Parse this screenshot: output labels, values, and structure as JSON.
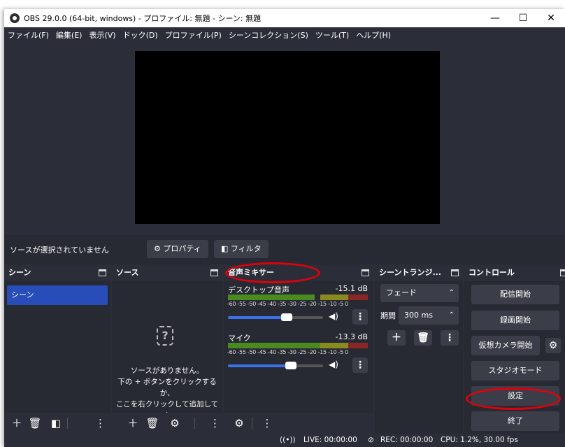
{
  "window": {
    "title": "OBS 29.0.0 (64-bit, windows) - プロファイル: 無題 - シーン: 無題",
    "minimize": "—",
    "maximize": "☐",
    "close": "✕"
  },
  "menu": [
    "ファイル(F)",
    "編集(E)",
    "表示(V)",
    "ドック(D)",
    "プロファイル(P)",
    "シーンコレクション(S)",
    "ツール(T)",
    "ヘルプ(H)"
  ],
  "source_bar": {
    "no_source": "ソースが選択されていません",
    "properties": "プロパティ",
    "filters": "フィルタ"
  },
  "scenes": {
    "title": "シーン",
    "items": [
      "シーン"
    ]
  },
  "sources": {
    "title": "ソース",
    "empty_line1": "ソースがありません。",
    "empty_line2": "下の + ボタンをクリックするか、",
    "empty_line3": "ここを右クリックして追加してく:"
  },
  "mixer": {
    "title": "音声ミキサー",
    "scale": "-60 -55 -50 -45 -40 -35 -30 -25 -20 -15 -10 -5 0",
    "channels": [
      {
        "name": "デスクトップ音声",
        "db": "-15.1 dB",
        "level": 0.62
      },
      {
        "name": "マイク",
        "db": "-13.3 dB",
        "level": 0.66
      }
    ]
  },
  "transitions": {
    "title": "シーントランジ...",
    "selected": "フェード",
    "duration_label": "期間",
    "duration": "300 ms"
  },
  "controls": {
    "title": "コントロール",
    "start_streaming": "配信開始",
    "start_recording": "録画開始",
    "start_virtualcam": "仮想カメラ開始",
    "studio_mode": "スタジオモード",
    "settings": "設定",
    "exit": "終了"
  },
  "status": {
    "live": "LIVE: 00:00:00",
    "rec": "REC: 00:00:00",
    "cpu": "CPU: 1.2%, 30.00 fps"
  },
  "colors": {
    "annotation": "#e0000b",
    "selected_scene": "#284cb8",
    "slider": "#3a73e8"
  }
}
